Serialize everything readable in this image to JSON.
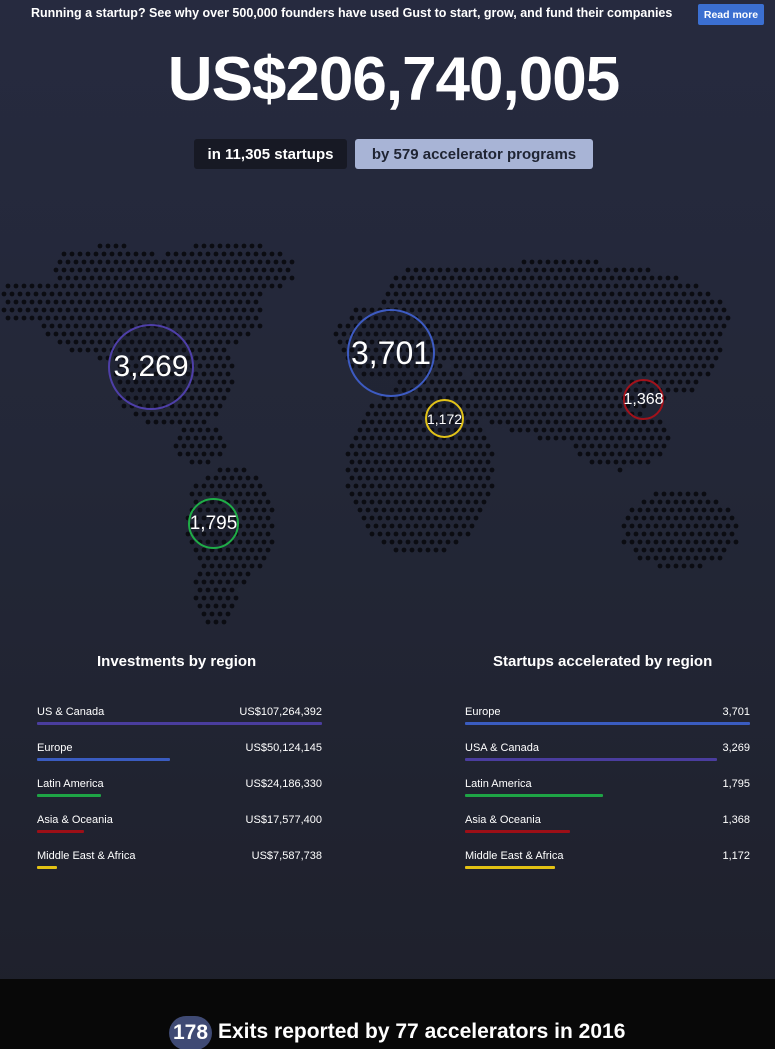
{
  "banner": {
    "text": "Running a startup? See why over 500,000 founders have used Gust to start, grow, and fund their companies",
    "button_label": "Read more"
  },
  "hero": {
    "amount": "US$206,740,005",
    "startups_pill": "in 11,305 startups",
    "programs_pill": "by 579 accelerator programs"
  },
  "map_bubbles": {
    "us_canada": "3,269",
    "europe": "3,701",
    "middle_east_africa": "1,172",
    "asia_oceania": "1,368",
    "latin_america": "1,795"
  },
  "investments": {
    "title": "Investments by region",
    "rows": [
      {
        "label": "US & Canada",
        "value": "US$107,264,392",
        "amount": 107264392,
        "color": "#4a3d9e"
      },
      {
        "label": "Europe",
        "value": "US$50,124,145",
        "amount": 50124145,
        "color": "#3a5cc0"
      },
      {
        "label": "Latin America",
        "value": "US$24,186,330",
        "amount": 24186330,
        "color": "#1ea445"
      },
      {
        "label": "Asia & Oceania",
        "value": "US$17,577,400",
        "amount": 17577400,
        "color": "#9d0f17"
      },
      {
        "label": "Middle East & Africa",
        "value": "US$7,587,738",
        "amount": 7587738,
        "color": "#e3c214"
      }
    ]
  },
  "startups": {
    "title": "Startups accelerated by region",
    "rows": [
      {
        "label": "Europe",
        "value": "3,701",
        "amount": 3701,
        "color": "#3a5cc0"
      },
      {
        "label": "USA & Canada",
        "value": "3,269",
        "amount": 3269,
        "color": "#4a3d9e"
      },
      {
        "label": "Latin America",
        "value": "1,795",
        "amount": 1795,
        "color": "#1ea445"
      },
      {
        "label": "Asia & Oceania",
        "value": "1,368",
        "amount": 1368,
        "color": "#9d0f17"
      },
      {
        "label": "Middle East & Africa",
        "value": "1,172",
        "amount": 1172,
        "color": "#e3c214"
      }
    ]
  },
  "exits": {
    "count": "178",
    "text": "Exits reported by 77 accelerators in 2016"
  }
}
